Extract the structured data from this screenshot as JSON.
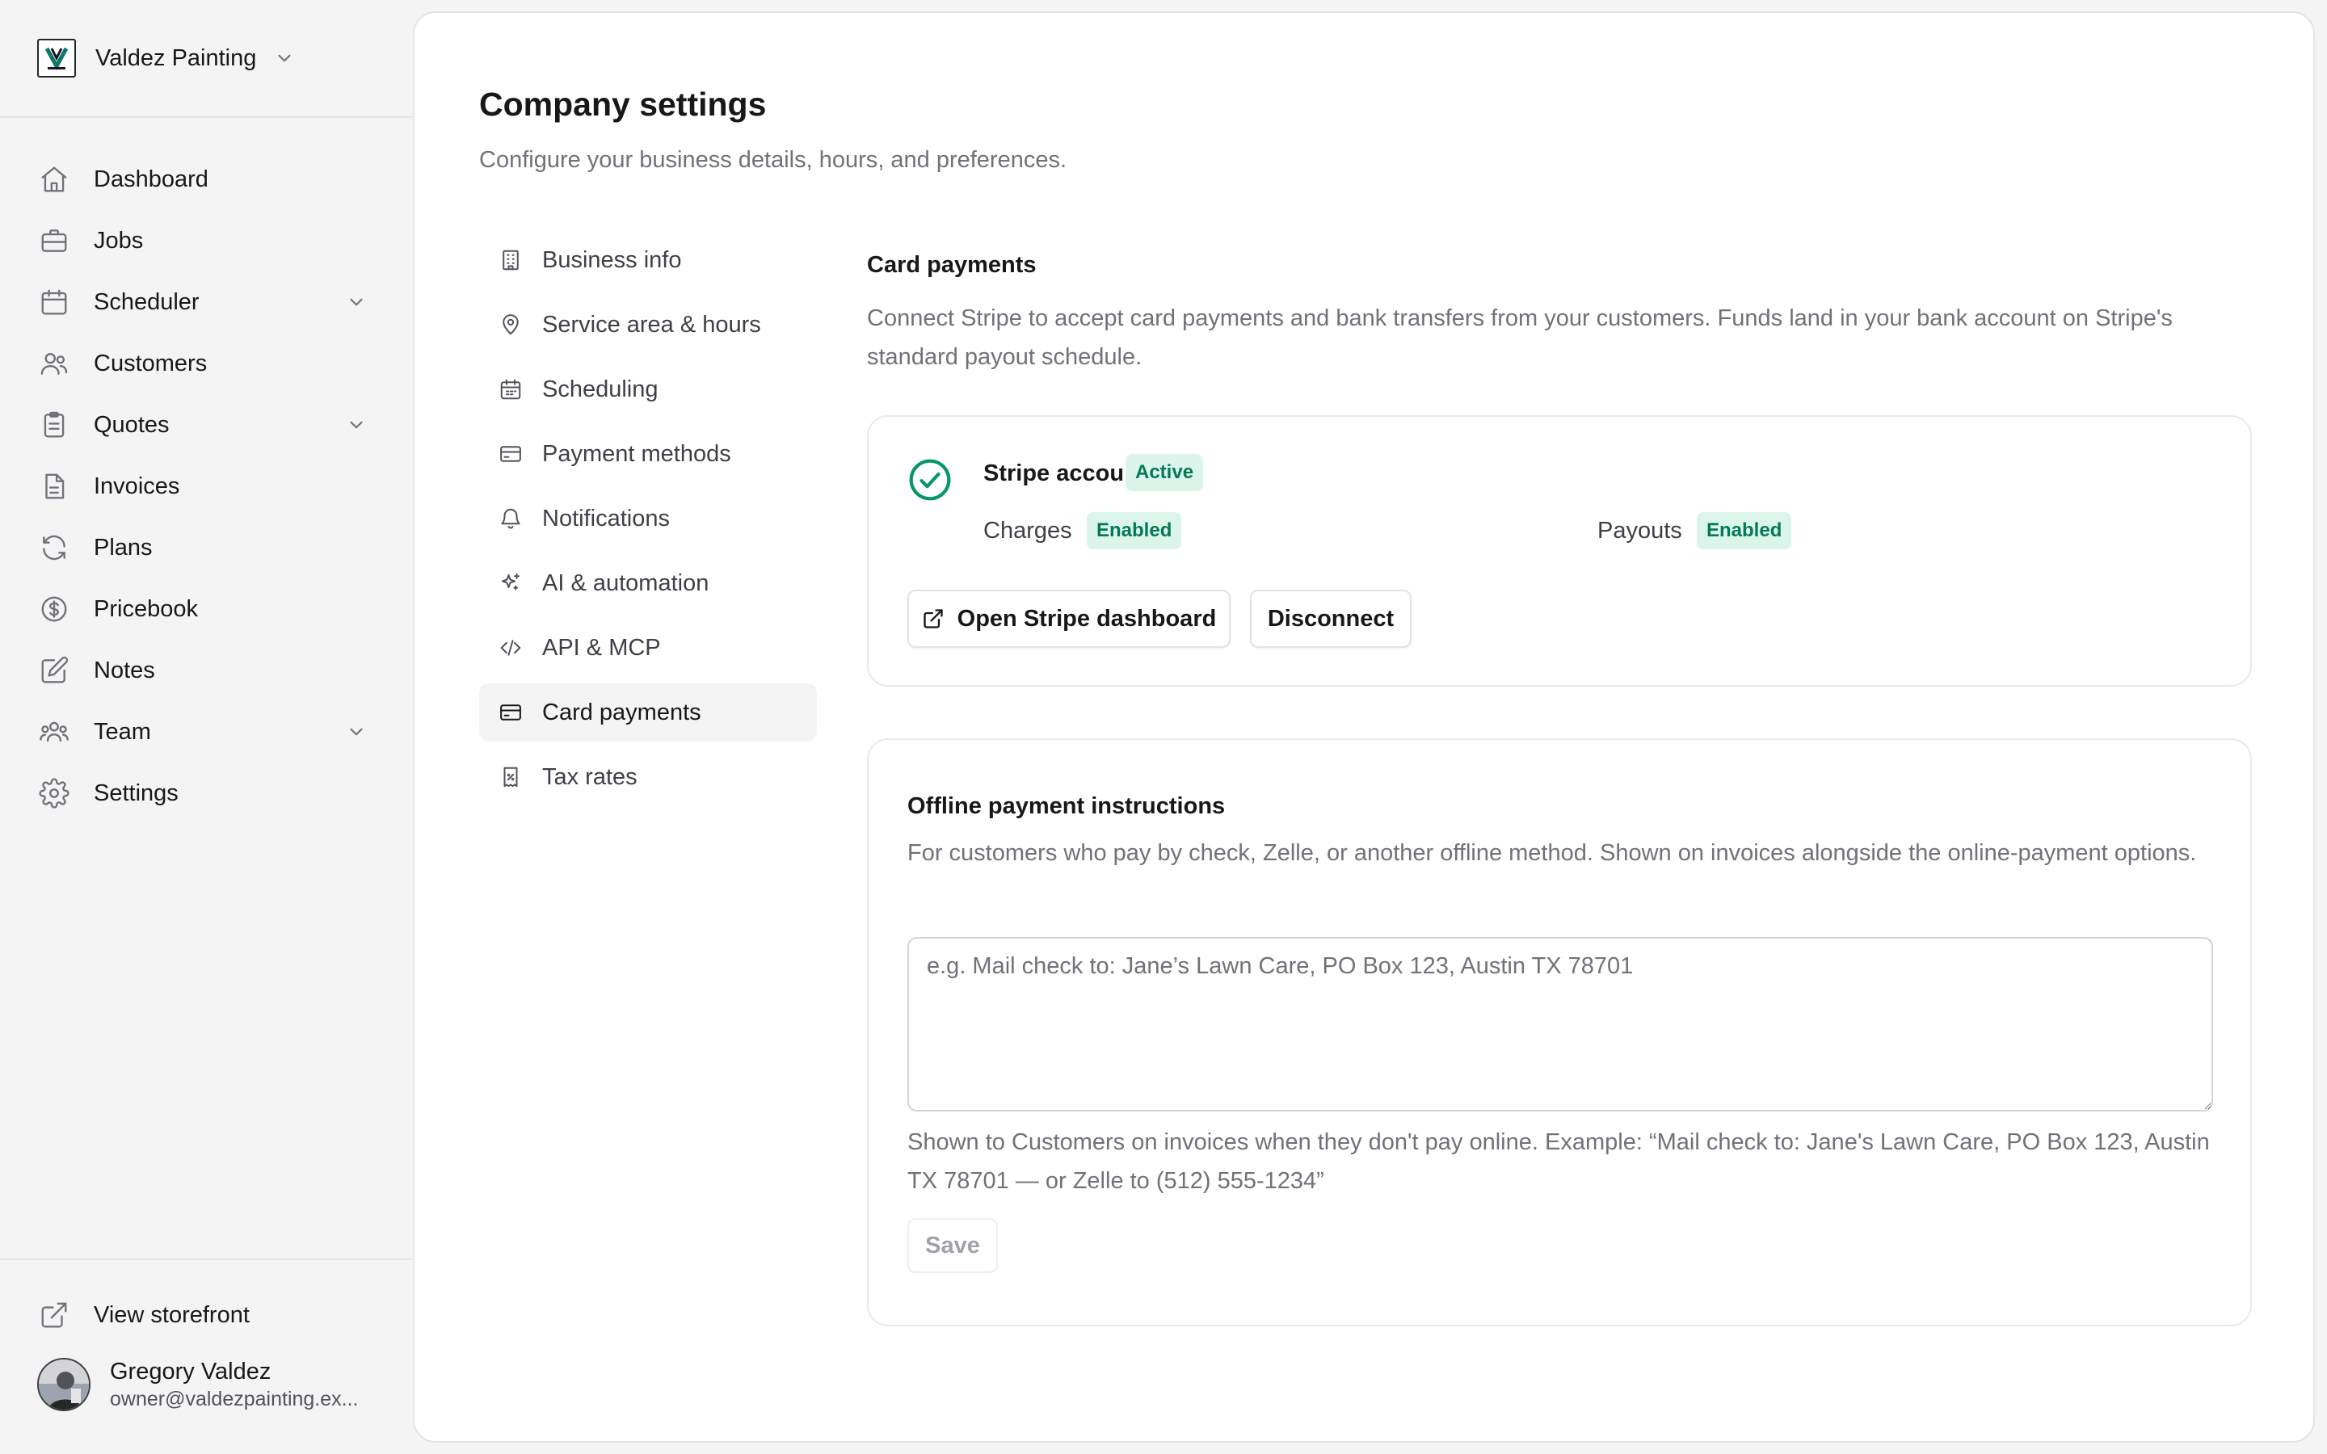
{
  "workspace": {
    "name": "Valdez Painting"
  },
  "nav": {
    "items": [
      {
        "label": "Dashboard",
        "icon": "home-icon"
      },
      {
        "label": "Jobs",
        "icon": "briefcase-icon"
      },
      {
        "label": "Scheduler",
        "icon": "calendar-icon",
        "expandable": true
      },
      {
        "label": "Customers",
        "icon": "users-icon"
      },
      {
        "label": "Quotes",
        "icon": "clipboard-icon",
        "expandable": true
      },
      {
        "label": "Invoices",
        "icon": "file-icon"
      },
      {
        "label": "Plans",
        "icon": "refresh-icon"
      },
      {
        "label": "Pricebook",
        "icon": "dollar-icon"
      },
      {
        "label": "Notes",
        "icon": "edit-icon"
      },
      {
        "label": "Team",
        "icon": "team-icon",
        "expandable": true
      },
      {
        "label": "Settings",
        "icon": "gear-icon"
      }
    ],
    "storefront_label": "View storefront"
  },
  "user": {
    "name": "Gregory Valdez",
    "email": "owner@valdezpainting.ex..."
  },
  "page": {
    "title": "Company settings",
    "subtitle": "Configure your business details, hours, and preferences."
  },
  "settings_nav": {
    "items": [
      {
        "label": "Business info",
        "icon": "building-icon"
      },
      {
        "label": "Service area & hours",
        "icon": "map-pin-icon"
      },
      {
        "label": "Scheduling",
        "icon": "calendar-icon"
      },
      {
        "label": "Payment methods",
        "icon": "credit-card-icon"
      },
      {
        "label": "Notifications",
        "icon": "bell-icon"
      },
      {
        "label": "AI & automation",
        "icon": "sparkles-icon"
      },
      {
        "label": "API & MCP",
        "icon": "code-icon"
      },
      {
        "label": "Card payments",
        "icon": "credit-card-icon",
        "active": true
      },
      {
        "label": "Tax rates",
        "icon": "receipt-icon"
      }
    ]
  },
  "card_payments": {
    "title": "Card payments",
    "description": "Connect Stripe to accept card payments and bank transfers from your customers. Funds land in your bank account on Stripe's standard payout schedule.",
    "stripe": {
      "title": "Stripe account",
      "status": "Active",
      "charges_label": "Charges",
      "charges_status": "Enabled",
      "payouts_label": "Payouts",
      "payouts_status": "Enabled",
      "open_dashboard_label": "Open Stripe dashboard",
      "disconnect_label": "Disconnect"
    },
    "offline": {
      "title": "Offline payment instructions",
      "description": "For customers who pay by check, Zelle, or another offline method. Shown on invoices alongside the online-payment options.",
      "value": "",
      "placeholder": "e.g. Mail check to: Jane’s Lawn Care, PO Box 123, Austin TX 78701",
      "hint": "Shown to Customers on invoices when they don't pay online. Example: “Mail check to: Jane's Lawn Care, PO Box 123, Austin TX 78701 — or Zelle to (512) 555-1234”",
      "save_label": "Save"
    }
  },
  "colors": {
    "accent_green": "#047857",
    "badge_bg": "#dcf5ea",
    "check_green": "#059669",
    "sidebar_bg": "#f4f4f5"
  }
}
